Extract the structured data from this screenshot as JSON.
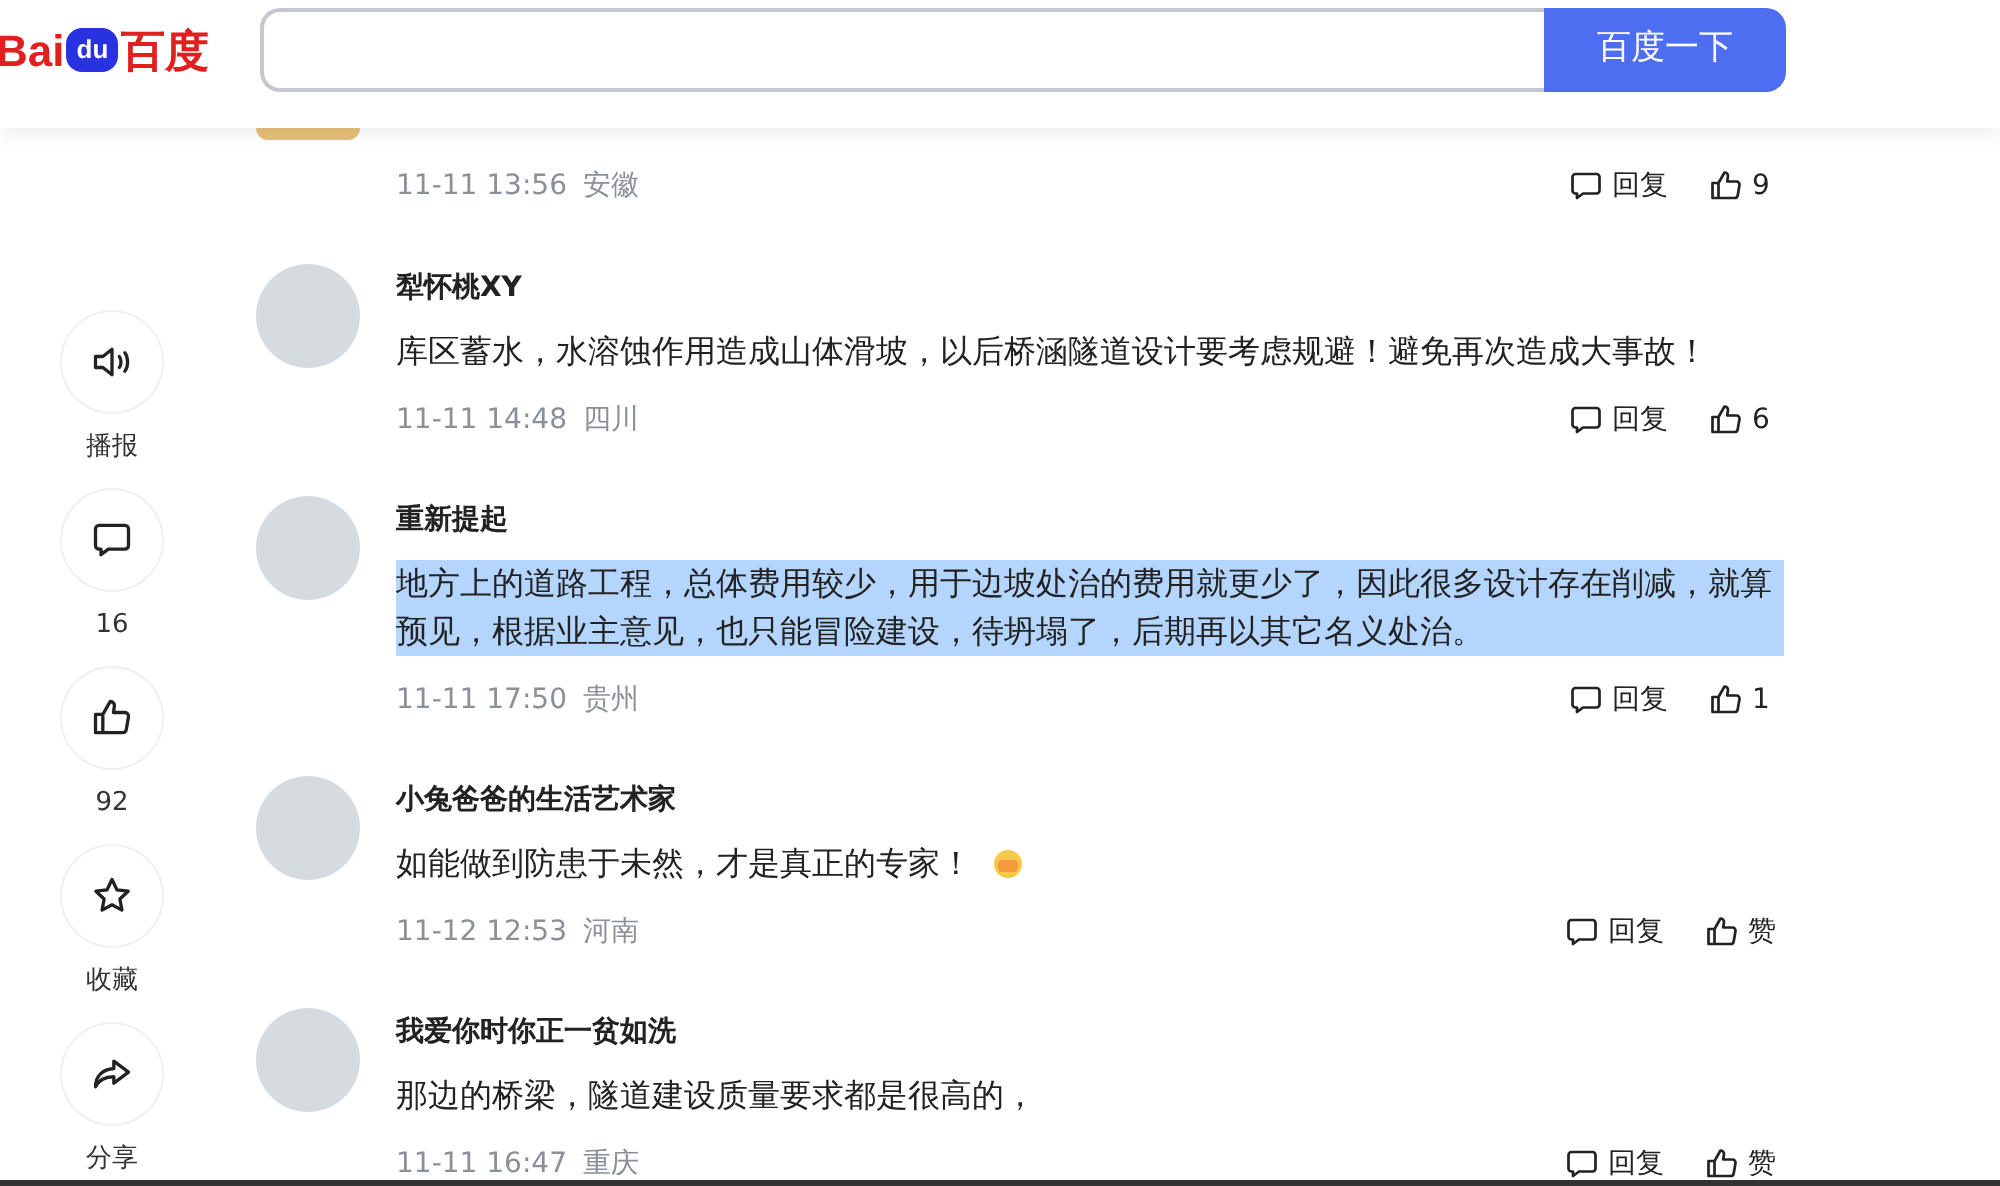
{
  "header": {
    "logo": {
      "latin": "Bai",
      "badge": "du",
      "chinese": "百度"
    },
    "search_button": "百度一下"
  },
  "side_actions": [
    {
      "kind": "speaker",
      "label": "播报"
    },
    {
      "kind": "comment",
      "label": "16"
    },
    {
      "kind": "like",
      "label": "92"
    },
    {
      "kind": "star",
      "label": "收藏"
    },
    {
      "kind": "share",
      "label": "分享"
    }
  ],
  "comments": [
    {
      "time": "11-11 13:56",
      "location": "安徽",
      "reply": "回复",
      "likes": "9"
    },
    {
      "name": "犁怀桃XY",
      "text": "库区蓄水，水溶蚀作用造成山体滑坡，以后桥涵隧道设计要考虑规避！避免再次造成大事故！",
      "has_emoji": false,
      "highlighted": false,
      "time": "11-11 14:48",
      "location": "四川",
      "reply": "回复",
      "likes": "6"
    },
    {
      "name": "重新提起",
      "text": "地方上的道路工程，总体费用较少，用于边坡处治的费用就更少了，因此很多设计存在削减，就算预见，根据业主意见，也只能冒险建设，待坍塌了，后期再以其它名义处治。",
      "has_emoji": false,
      "highlighted": true,
      "time": "11-11 17:50",
      "location": "贵州",
      "reply": "回复",
      "likes": "1"
    },
    {
      "name": "小兔爸爸的生活艺术家",
      "text": "如能做到防患于未然，才是真正的专家！",
      "has_emoji": true,
      "highlighted": false,
      "time": "11-12 12:53",
      "location": "河南",
      "reply": "回复",
      "likes": "赞"
    },
    {
      "name": "我爱你时你正一贫如洗",
      "text": "那边的桥梁，隧道建设质量要求都是很高的，",
      "has_emoji": false,
      "highlighted": false,
      "time": "11-11 16:47",
      "location": "重庆",
      "reply": "回复",
      "likes": "赞"
    }
  ]
}
